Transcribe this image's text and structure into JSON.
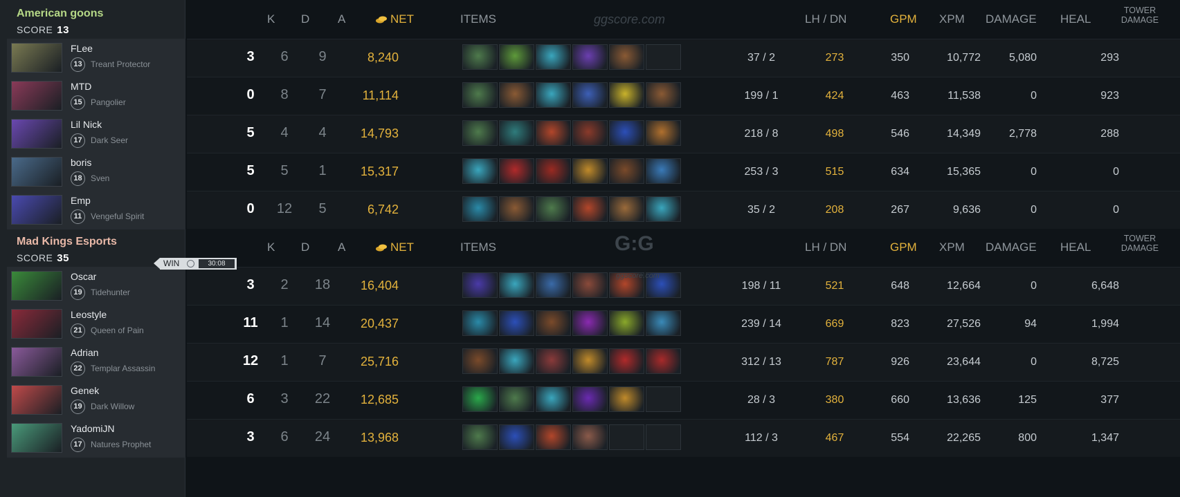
{
  "teams": [
    {
      "name": "American goons",
      "name_color": "#b6d987",
      "score_label": "SCORE",
      "score": "13",
      "players": [
        {
          "player": "FLee",
          "level": "13",
          "hero": "Treant Protector",
          "k": "3",
          "d": "6",
          "a": "9",
          "net": "8,240",
          "lh_dn": "37  /  2",
          "gpm": "273",
          "xpm": "350",
          "damage": "10,772",
          "heal": "5,080",
          "tower": "293",
          "items": [
            "#4e7a4c",
            "#5e9a3a",
            "#3aa6bd",
            "#6b3fb0",
            "#8a5a34",
            "empty"
          ],
          "portrait": "#7a7a52"
        },
        {
          "player": "MTD",
          "level": "15",
          "hero": "Pangolier",
          "k": "0",
          "d": "8",
          "a": "7",
          "net": "11,114",
          "lh_dn": "199  /  1",
          "gpm": "424",
          "xpm": "463",
          "damage": "11,538",
          "heal": "0",
          "tower": "923",
          "items": [
            "#4e7a4c",
            "#8a5a34",
            "#3aa6bd",
            "#3d5fb6",
            "#c9b22a",
            "#8a5a34"
          ],
          "portrait": "#8a3a58"
        },
        {
          "player": "Lil Nick",
          "level": "17",
          "hero": "Dark Seer",
          "k": "5",
          "d": "4",
          "a": "4",
          "net": "14,793",
          "lh_dn": "218  /  8",
          "gpm": "498",
          "xpm": "546",
          "damage": "14,349",
          "heal": "2,778",
          "tower": "288",
          "items": [
            "#4e7a4c",
            "#2f7c7c",
            "#b2462a",
            "#8a3a2a",
            "#2c4fb8",
            "#b0702e"
          ],
          "portrait": "#6a48b0"
        },
        {
          "player": "boris",
          "level": "18",
          "hero": "Sven",
          "k": "5",
          "d": "5",
          "a": "1",
          "net": "15,317",
          "lh_dn": "253  /  3",
          "gpm": "515",
          "xpm": "634",
          "damage": "15,365",
          "heal": "0",
          "tower": "0",
          "items": [
            "#3aa6bd",
            "#b02a2a",
            "#9a2a22",
            "#c08a2a",
            "#7a4a2a",
            "#3a7ab8"
          ],
          "portrait": "#4a6a8a"
        },
        {
          "player": "Emp",
          "level": "11",
          "hero": "Vengeful Spirit",
          "k": "0",
          "d": "12",
          "a": "5",
          "net": "6,742",
          "lh_dn": "35  /  2",
          "gpm": "208",
          "xpm": "267",
          "damage": "9,636",
          "heal": "0",
          "tower": "0",
          "items": [
            "#2a8aa8",
            "#8a5a34",
            "#4e7a4c",
            "#b2462a",
            "#9a6a3a",
            "#3aa6bd"
          ],
          "portrait": "#4a4ab0"
        }
      ]
    },
    {
      "name": "Mad Kings Esports",
      "name_color": "#e9b9a8",
      "score_label": "SCORE",
      "score": "35",
      "players": [
        {
          "player": "Oscar",
          "level": "19",
          "hero": "Tidehunter",
          "k": "3",
          "d": "2",
          "a": "18",
          "net": "16,404",
          "lh_dn": "198  /  11",
          "gpm": "521",
          "xpm": "648",
          "damage": "12,664",
          "heal": "0",
          "tower": "6,648",
          "items": [
            "#4a3aa8",
            "#3aa6bd",
            "#3a6aa8",
            "#8a4a3a",
            "#b2462a",
            "#2c4fb8"
          ],
          "portrait": "#3a8a3a"
        },
        {
          "player": "Leostyle",
          "level": "21",
          "hero": "Queen of Pain",
          "k": "11",
          "d": "1",
          "a": "14",
          "net": "20,437",
          "lh_dn": "239  /  14",
          "gpm": "669",
          "xpm": "823",
          "damage": "27,526",
          "heal": "94",
          "tower": "1,994",
          "items": [
            "#2a8aa8",
            "#2c4fb8",
            "#7a4a2a",
            "#8a2ab0",
            "#8aa82a",
            "#3a8ab8"
          ],
          "portrait": "#8a2a3a"
        },
        {
          "player": "Adrian",
          "level": "22",
          "hero": "Templar Assassin",
          "k": "12",
          "d": "1",
          "a": "7",
          "net": "25,716",
          "lh_dn": "312  /  13",
          "gpm": "787",
          "xpm": "926",
          "damage": "23,644",
          "heal": "0",
          "tower": "8,725",
          "items": [
            "#7a4a2a",
            "#3aa6bd",
            "#8a3a3a",
            "#c08a2a",
            "#b02a2a",
            "#a82a2a"
          ],
          "portrait": "#8a5a9a"
        },
        {
          "player": "Genek",
          "level": "19",
          "hero": "Dark Willow",
          "k": "6",
          "d": "3",
          "a": "22",
          "net": "12,685",
          "lh_dn": "28  /  3",
          "gpm": "380",
          "xpm": "660",
          "damage": "13,636",
          "heal": "125",
          "tower": "377",
          "items": [
            "#2aa84a",
            "#4e7a4c",
            "#3aa6bd",
            "#6a2ab0",
            "#c08a2a",
            "empty"
          ],
          "portrait": "#c04a4a"
        },
        {
          "player": "YadomiJN",
          "level": "17",
          "hero": "Natures Prophet",
          "k": "3",
          "d": "6",
          "a": "24",
          "net": "13,968",
          "lh_dn": "112  /  3",
          "gpm": "467",
          "xpm": "554",
          "damage": "22,265",
          "heal": "800",
          "tower": "1,347",
          "items": [
            "#4e7a4c",
            "#2c4fb8",
            "#b2462a",
            "#8a5a4a",
            "empty",
            "empty"
          ],
          "portrait": "#4a9a7a"
        }
      ]
    }
  ],
  "headers": {
    "k": "K",
    "d": "D",
    "a": "A",
    "net": "NET",
    "items": "ITEMS",
    "lh_dn": "LH  /  DN",
    "gpm": "GPM",
    "xpm": "XPM",
    "damage": "DAMAGE",
    "heal": "HEAL",
    "tower_line1": "TOWER",
    "tower_line2": "DAMAGE"
  },
  "result": {
    "label": "WIN",
    "duration": "30:08"
  },
  "watermarks": {
    "top": "ggscore.com",
    "mid_logo": "G:G",
    "mid_sub": "ggscore.com"
  },
  "colors": {
    "gold": "#e3b23c",
    "header": "#8f969c"
  }
}
